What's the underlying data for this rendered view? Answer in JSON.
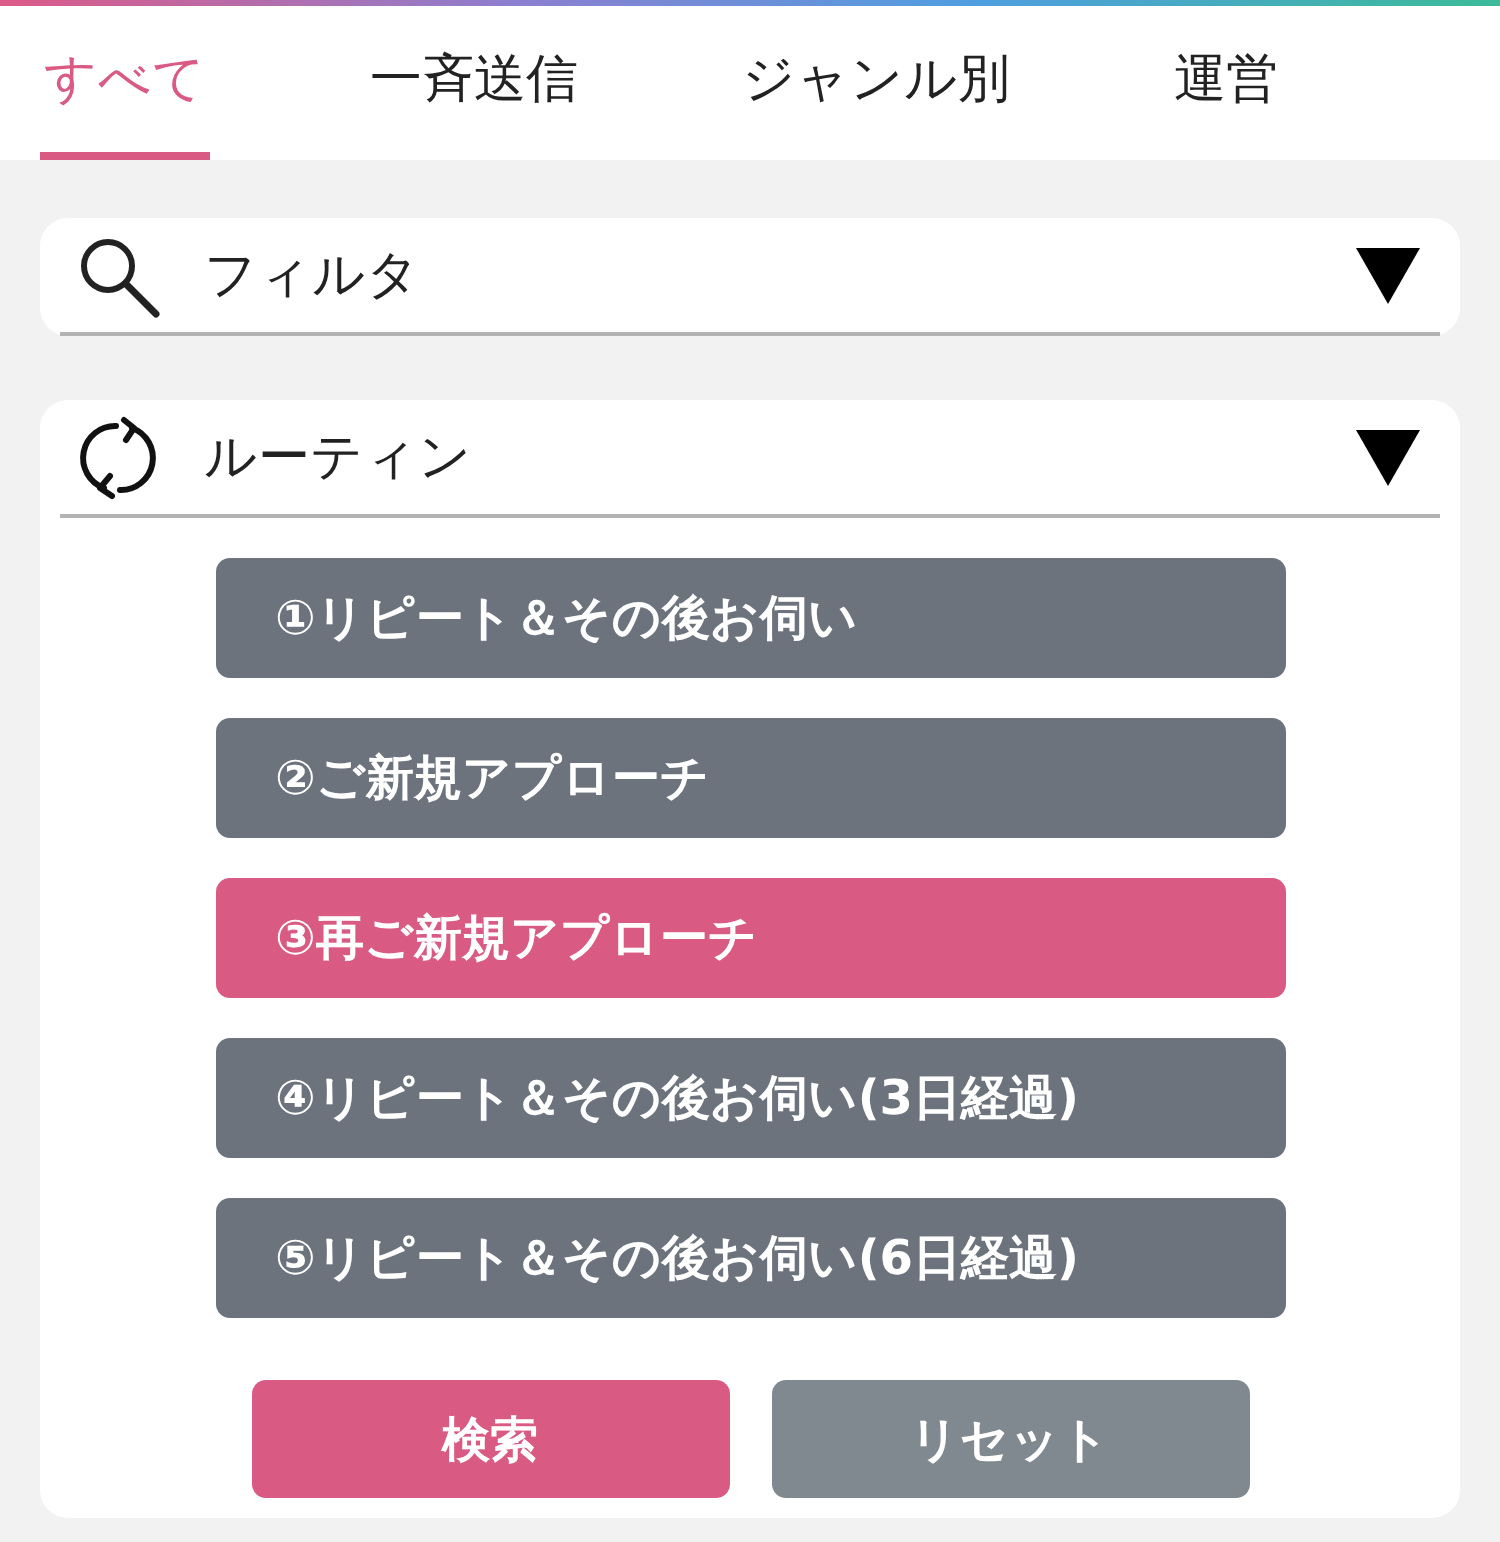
{
  "tabs": [
    {
      "label": "すべて",
      "selected": true
    },
    {
      "label": "一斉送信",
      "selected": false
    },
    {
      "label": "ジャンル別",
      "selected": false
    },
    {
      "label": "運営",
      "selected": false
    }
  ],
  "filter": {
    "label": "フィルタ"
  },
  "routine": {
    "label": "ルーティン",
    "options": [
      {
        "label": "①リピート＆その後お伺い",
        "selected": false
      },
      {
        "label": "②ご新規アプローチ",
        "selected": false
      },
      {
        "label": "③再ご新規アプローチ",
        "selected": true
      },
      {
        "label": "④リピート＆その後お伺い(3日経過)",
        "selected": false
      },
      {
        "label": "⑤リピート＆その後お伺い(6日経過)",
        "selected": false
      }
    ]
  },
  "actions": [
    {
      "label": "検索",
      "kind": "primary"
    },
    {
      "label": "リセット",
      "kind": "secondary"
    }
  ]
}
